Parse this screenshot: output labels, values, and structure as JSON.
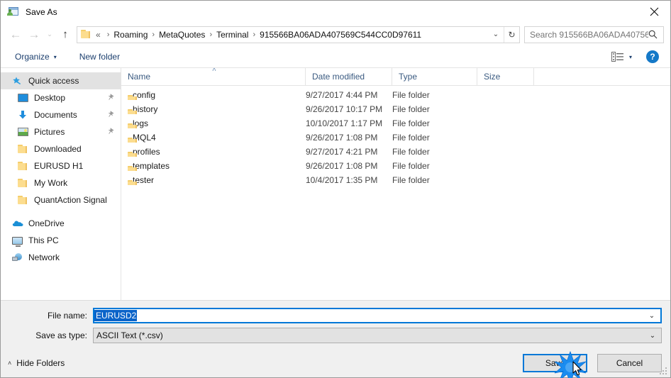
{
  "window": {
    "title": "Save As",
    "icon": "save-as-icon",
    "close_label": "✕"
  },
  "nav": {
    "back_icon": "←",
    "forward_icon": "→",
    "recent_icon": "⌄",
    "up_icon": "↑",
    "breadcrumbs": [
      "Roaming",
      "MetaQuotes",
      "Terminal",
      "915566BA06ADA407569C544CC0D97611"
    ],
    "crumb_prefix": "«",
    "separator": "›",
    "dropdown_icon": "⌄",
    "refresh_icon": "↻"
  },
  "search": {
    "placeholder": "Search 915566BA06ADA40756...",
    "icon": "search-icon"
  },
  "toolbar": {
    "organize_label": "Organize",
    "organize_caret": "▾",
    "new_folder_label": "New folder",
    "view_caret": "▾",
    "help_label": "?"
  },
  "sidebar": {
    "quick_access": {
      "label": "Quick access",
      "icon": "star-pin-icon",
      "selected": true
    },
    "quick_items": [
      {
        "label": "Desktop",
        "icon": "desktop-icon",
        "pinned": true
      },
      {
        "label": "Documents",
        "icon": "documents-icon",
        "pinned": true
      },
      {
        "label": "Pictures",
        "icon": "pictures-icon",
        "pinned": true
      },
      {
        "label": "Downloaded",
        "icon": "folder-icon",
        "pinned": false
      },
      {
        "label": "EURUSD H1",
        "icon": "folder-icon",
        "pinned": false
      },
      {
        "label": "My Work",
        "icon": "folder-icon",
        "pinned": false
      },
      {
        "label": "QuantAction Signal",
        "icon": "folder-icon",
        "pinned": false
      }
    ],
    "roots": [
      {
        "label": "OneDrive",
        "icon": "onedrive-icon"
      },
      {
        "label": "This PC",
        "icon": "this-pc-icon"
      },
      {
        "label": "Network",
        "icon": "network-icon"
      }
    ],
    "pin_icon": "📌"
  },
  "filelist": {
    "columns": [
      "Name",
      "Date modified",
      "Type",
      "Size"
    ],
    "sort_indicator": "˄",
    "rows": [
      {
        "name": "config",
        "date": "9/27/2017 4:44 PM",
        "type": "File folder",
        "size": ""
      },
      {
        "name": "history",
        "date": "9/26/2017 10:17 PM",
        "type": "File folder",
        "size": ""
      },
      {
        "name": "logs",
        "date": "10/10/2017 1:17 PM",
        "type": "File folder",
        "size": ""
      },
      {
        "name": "MQL4",
        "date": "9/26/2017 1:08 PM",
        "type": "File folder",
        "size": ""
      },
      {
        "name": "profiles",
        "date": "9/27/2017 4:21 PM",
        "type": "File folder",
        "size": ""
      },
      {
        "name": "templates",
        "date": "9/26/2017 1:08 PM",
        "type": "File folder",
        "size": ""
      },
      {
        "name": "tester",
        "date": "10/4/2017 1:35 PM",
        "type": "File folder",
        "size": ""
      }
    ]
  },
  "form": {
    "filename_label": "File name:",
    "filename_value": "EURUSD2",
    "filetype_label": "Save as type:",
    "filetype_value": "ASCII Text (*.csv)",
    "dropdown_icon": "⌄"
  },
  "footer": {
    "hide_folders_label": "Hide Folders",
    "hide_folders_chevron": "˄",
    "save_label": "Save",
    "cancel_label": "Cancel"
  },
  "colors": {
    "accent": "#0078d7",
    "selection_blue": "#0a63c9",
    "folder_yellow": "#fcdd8f",
    "link_blue": "#1c3f6e",
    "help_blue": "#1579c8"
  }
}
